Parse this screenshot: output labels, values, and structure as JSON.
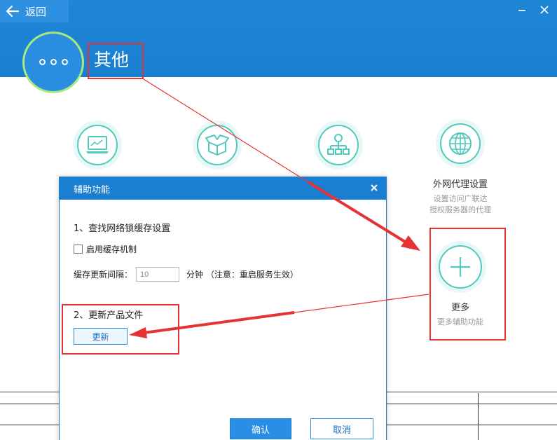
{
  "nav": {
    "back_label": "返回"
  },
  "page": {
    "title": "其他"
  },
  "features": [
    {
      "icon": "laptop-chart-icon",
      "title": "",
      "desc1": "",
      "desc2": ""
    },
    {
      "icon": "box-icon",
      "title": "",
      "desc1": "",
      "desc2": ""
    },
    {
      "icon": "network-tree-icon",
      "title": "",
      "desc1": "",
      "desc2": ""
    },
    {
      "icon": "globe-icon",
      "title": "外网代理设置",
      "desc1": "设置访问广联达",
      "desc2": "授权服务器的代理"
    }
  ],
  "more": {
    "icon": "plus-icon",
    "title": "更多",
    "desc": "更多辅助功能"
  },
  "dialog": {
    "title": "辅助功能",
    "section1": "1、查找网络锁缓存设置",
    "enable_cache_label": "启用缓存机制",
    "enable_cache_checked": false,
    "interval_label": "缓存更新间隔：",
    "interval_value": "10",
    "interval_unit": "分钟 （注意：重启服务生效）",
    "section2": "2、更新产品文件",
    "update_label": "更新",
    "ok_label": "确认",
    "cancel_label": "取消"
  },
  "colors": {
    "header_blue": "#1a7fd0",
    "accent_green": "#4fcabb",
    "highlight_red": "#e63232"
  }
}
